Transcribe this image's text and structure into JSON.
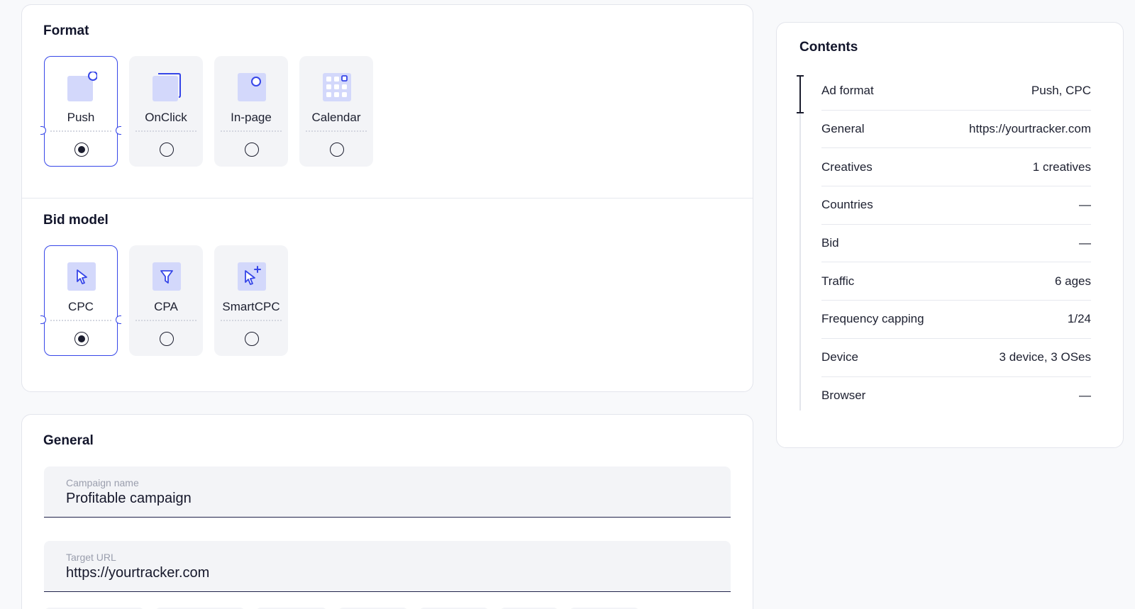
{
  "format": {
    "title": "Format",
    "options": [
      {
        "label": "Push",
        "selected": true
      },
      {
        "label": "OnClick",
        "selected": false
      },
      {
        "label": "In-page",
        "selected": false
      },
      {
        "label": "Calendar",
        "selected": false
      }
    ]
  },
  "bid_model": {
    "title": "Bid model",
    "options": [
      {
        "label": "CPC",
        "selected": true
      },
      {
        "label": "CPA",
        "selected": false
      },
      {
        "label": "SmartCPC",
        "selected": false
      }
    ]
  },
  "general": {
    "title": "General",
    "campaign_name": {
      "label": "Campaign name",
      "value": "Profitable campaign"
    },
    "target_url": {
      "label": "Target URL",
      "value": "https://yourtracker.com"
    }
  },
  "contents": {
    "title": "Contents",
    "rows": [
      {
        "label": "Ad format",
        "value": "Push, CPC"
      },
      {
        "label": "General",
        "value": "https://yourtracker.com"
      },
      {
        "label": "Creatives",
        "value": "1 creatives"
      },
      {
        "label": "Countries",
        "value": "—"
      },
      {
        "label": "Bid",
        "value": "—"
      },
      {
        "label": "Traffic",
        "value": "6 ages"
      },
      {
        "label": "Frequency capping",
        "value": "1/24"
      },
      {
        "label": "Device",
        "value": "3 device, 3 OSes"
      },
      {
        "label": "Browser",
        "value": "—"
      }
    ]
  },
  "colors": {
    "accent": "#3646e8",
    "icon_fill": "#d3d8fb",
    "tile_bg": "#f3f4f7"
  }
}
